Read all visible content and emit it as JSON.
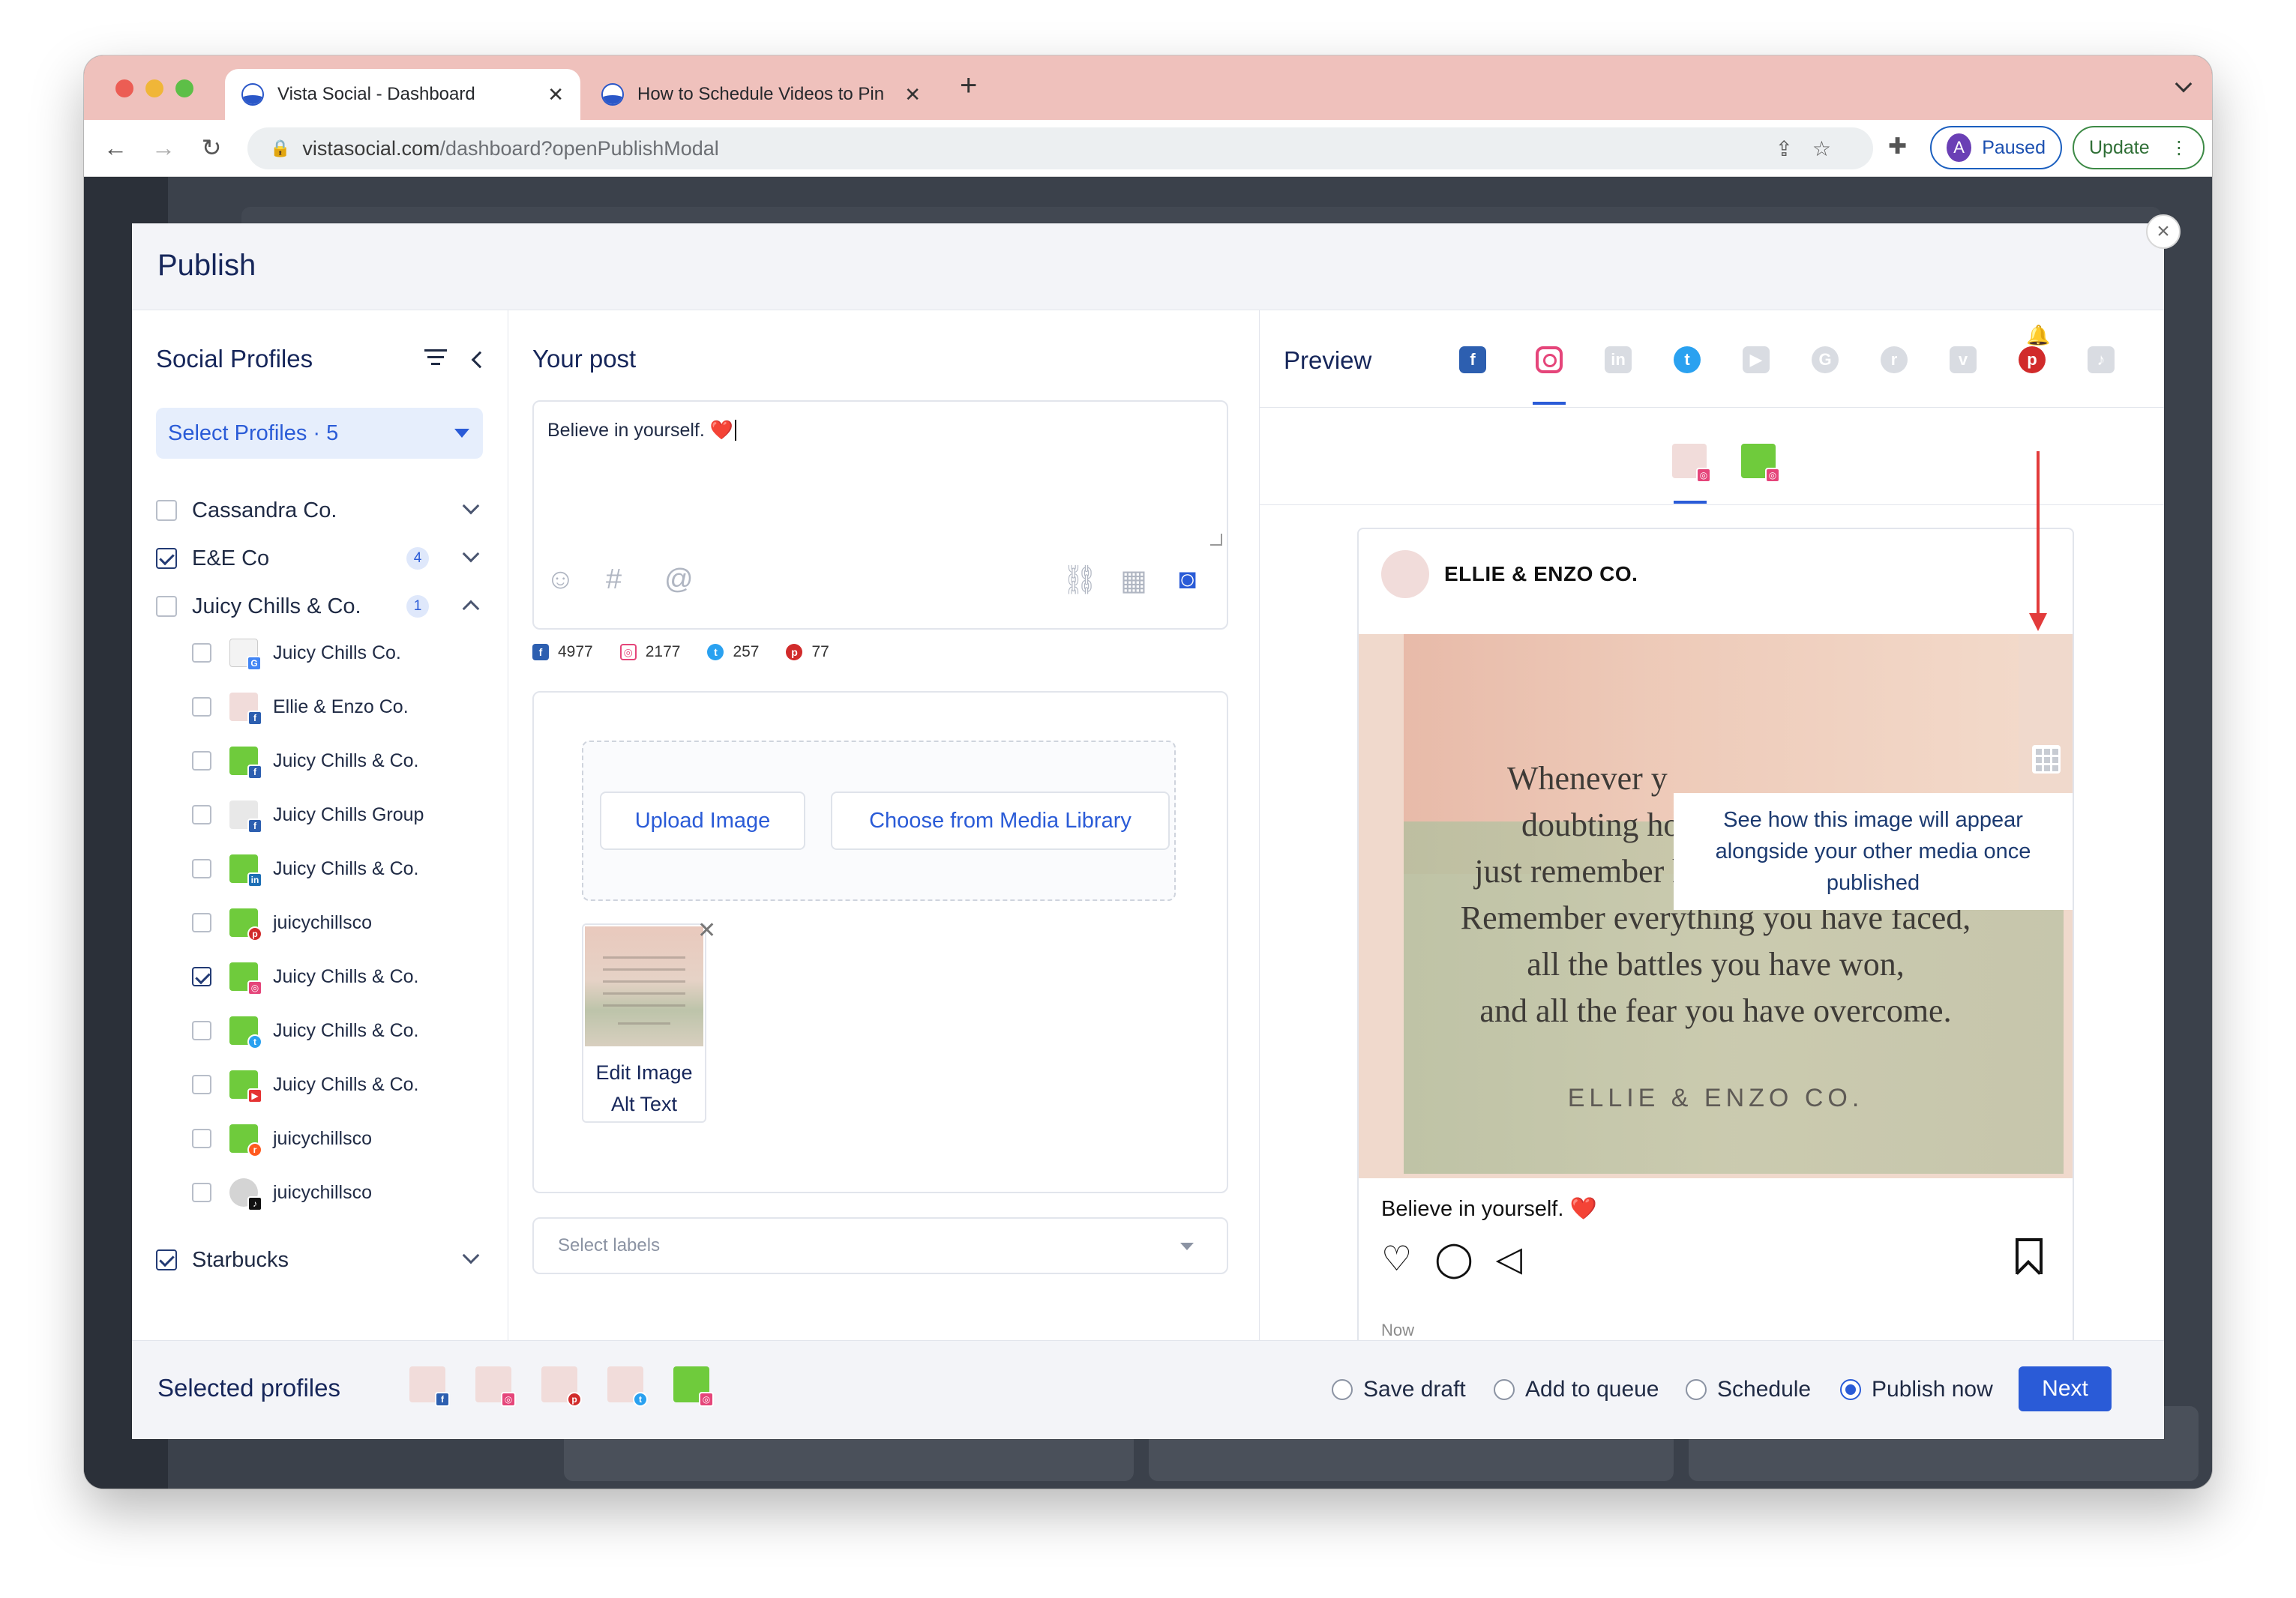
{
  "browser": {
    "tabs": [
      {
        "title": "Vista Social - Dashboard",
        "active": true
      },
      {
        "title": "How to Schedule Videos to Pin",
        "active": false
      }
    ],
    "new_tab": "+",
    "url_host": "vistasocial.com",
    "url_path": "/dashboard?openPublishModal",
    "profile_initial": "A",
    "profile_status": "Paused",
    "update_label": "Update"
  },
  "modal": {
    "title": "Publish",
    "close": "×"
  },
  "profiles": {
    "title": "Social Profiles",
    "select_label": "Select Profiles · 5",
    "groups": [
      {
        "name": "Cassandra Co.",
        "checked": false
      },
      {
        "name": "E&E Co",
        "checked": true,
        "count": "4"
      },
      {
        "name": "Juicy Chills & Co.",
        "checked": false,
        "count": "1"
      },
      {
        "name": "Starbucks",
        "checked": true
      }
    ],
    "items": [
      {
        "name": "Juicy Chills Co.",
        "network": "google-icon",
        "checked": false
      },
      {
        "name": "Ellie & Enzo Co.",
        "network": "facebook-icon",
        "checked": false
      },
      {
        "name": "Juicy Chills & Co.",
        "network": "facebook-icon",
        "checked": false
      },
      {
        "name": "Juicy Chills Group",
        "network": "facebook-icon",
        "checked": false
      },
      {
        "name": "Juicy Chills & Co.",
        "network": "linkedin-icon",
        "checked": false
      },
      {
        "name": "juicychillsco",
        "network": "pinterest-icon",
        "checked": false
      },
      {
        "name": "Juicy Chills & Co.",
        "network": "instagram-icon",
        "checked": true
      },
      {
        "name": "Juicy Chills & Co.",
        "network": "twitter-icon",
        "checked": false
      },
      {
        "name": "Juicy Chills & Co.",
        "network": "youtube-icon",
        "checked": false
      },
      {
        "name": "juicychillsco",
        "network": "reddit-icon",
        "checked": false
      },
      {
        "name": "juicychillsco",
        "network": "tiktok-icon",
        "checked": false
      }
    ]
  },
  "post": {
    "title": "Your post",
    "text": "Believe in yourself.",
    "emoji": "❤️",
    "counts": [
      {
        "network": "facebook",
        "value": "4977"
      },
      {
        "network": "instagram",
        "value": "2177"
      },
      {
        "network": "twitter",
        "value": "257"
      },
      {
        "network": "pinterest",
        "value": "77"
      }
    ],
    "upload_label": "Upload Image",
    "library_label": "Choose from Media Library",
    "alt_text_line1": "Edit Image",
    "alt_text_line2": "Alt Text",
    "labels_placeholder": "Select labels"
  },
  "preview": {
    "title": "Preview",
    "account_name": "ELLIE & ENZO CO.",
    "quote_lines": [
      "Whenever y",
      "doubting how far you can go,",
      "just remember how far you've come.",
      "Remember everything you have faced,",
      "all the battles you have won,",
      "and all the fear you have overcome."
    ],
    "brand": "ELLIE & ENZO CO.",
    "tooltip": "See how this image will appear alongside your other media once published",
    "caption": "Believe in yourself.",
    "caption_emoji": "❤️",
    "time": "Now"
  },
  "footer": {
    "title": "Selected profiles",
    "options": [
      {
        "label": "Save draft",
        "selected": false
      },
      {
        "label": "Add to queue",
        "selected": false
      },
      {
        "label": "Schedule",
        "selected": false
      },
      {
        "label": "Publish now",
        "selected": true
      }
    ],
    "next_label": "Next"
  },
  "colors": {
    "accent": "#2a5bd7",
    "tab_strip": "#efc1bc",
    "heading": "#16265a"
  }
}
